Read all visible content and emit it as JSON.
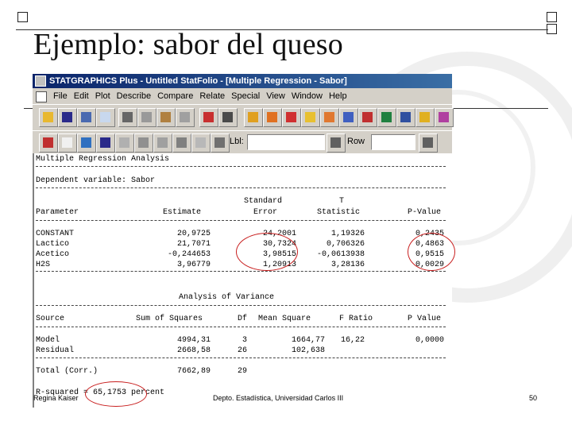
{
  "slide": {
    "title": "Ejemplo: sabor del queso",
    "footer_left": "Regina Kaiser",
    "footer_center": "Depto. Estadística, Universidad Carlos III",
    "page_number": "50"
  },
  "window": {
    "title": "STATGRAPHICS Plus - Untitled StatFolio - [Multiple Regression - Sabor]"
  },
  "menu": [
    "File",
    "Edit",
    "Plot",
    "Describe",
    "Compare",
    "Relate",
    "Special",
    "View",
    "Window",
    "Help"
  ],
  "toolbar": {
    "lbl_label": "Lbl:",
    "row_label": "Row",
    "lbl_value": "",
    "row_value": ""
  },
  "output": {
    "heading": "Multiple Regression Analysis",
    "dependent": "Dependent variable: Sabor",
    "coef_header": {
      "parameter": "Parameter",
      "estimate": "Estimate",
      "stderr_1": "Standard",
      "stderr_2": "Error",
      "tstat_1": "T",
      "tstat_2": "Statistic",
      "pvalue": "P-Value"
    },
    "coef_rows": [
      {
        "parameter": "CONSTANT",
        "estimate": "20,9725",
        "stderr": "24,2001",
        "tstat": "1,19326",
        "pvalue": "0,2435"
      },
      {
        "parameter": "Lactico",
        "estimate": "21,7071",
        "stderr": "30,7324",
        "tstat": "0,706326",
        "pvalue": "0,4863"
      },
      {
        "parameter": "Acetico",
        "estimate": "-0,244653",
        "stderr": "3,98515",
        "tstat": "-0,0613938",
        "pvalue": "0,9515"
      },
      {
        "parameter": "H2S",
        "estimate": "3,96779",
        "stderr": "1,20913",
        "tstat": "3,28136",
        "pvalue": "0,0029"
      }
    ],
    "anova_title": "Analysis of Variance",
    "anova_header": {
      "source": "Source",
      "ss": "Sum of Squares",
      "df": "Df",
      "ms": "Mean Square",
      "f": "F Ratio",
      "p": "P Value"
    },
    "anova_rows": [
      {
        "source": "Model",
        "ss": "4994,31",
        "df": "3",
        "ms": "1664,77",
        "f": "16,22",
        "p": "0,0000"
      },
      {
        "source": "Residual",
        "ss": "2668,58",
        "df": "26",
        "ms": "102,638",
        "f": "",
        "p": ""
      }
    ],
    "total_row": {
      "source": "Total (Corr.)",
      "ss": "7662,89",
      "df": "29"
    },
    "rsquared": "R-squared = 65,1753 percent"
  },
  "colors": {
    "highlight": "#c81e1e",
    "titlebar": "#0a246a"
  }
}
